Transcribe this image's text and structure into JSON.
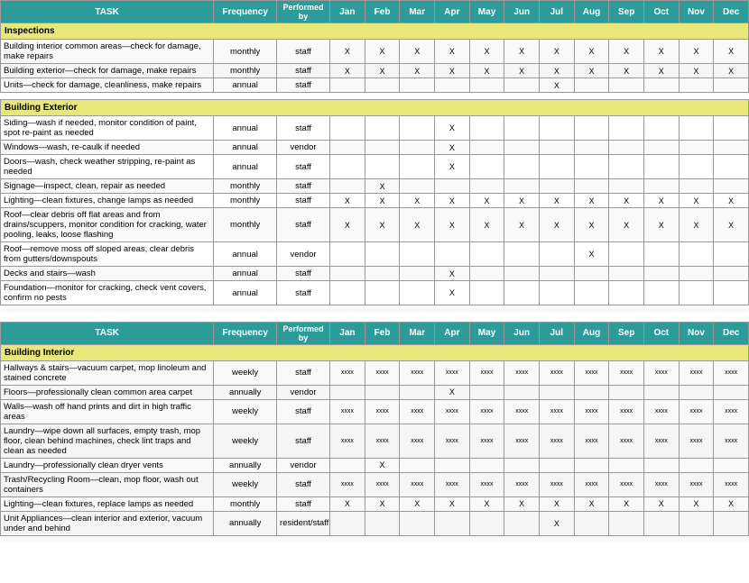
{
  "table": {
    "headers": {
      "task": "TASK",
      "frequency": "Frequency",
      "performed_by": "Performed by",
      "months": [
        "Jan",
        "Feb",
        "Mar",
        "Apr",
        "May",
        "Jun",
        "Jul",
        "Aug",
        "Sep",
        "Oct",
        "Nov",
        "Dec"
      ]
    },
    "sections": [
      {
        "name": "Inspections",
        "rows": [
          {
            "task": "Building interior common areas—check for damage, make repairs",
            "frequency": "monthly",
            "performed_by": "staff",
            "months": [
              "X",
              "X",
              "X",
              "X",
              "X",
              "X",
              "X",
              "X",
              "X",
              "X",
              "X",
              "X"
            ]
          },
          {
            "task": "Building exterior—check for damage, make repairs",
            "frequency": "monthly",
            "performed_by": "staff",
            "months": [
              "X",
              "X",
              "X",
              "X",
              "X",
              "X",
              "X",
              "X",
              "X",
              "X",
              "X",
              "X"
            ]
          },
          {
            "task": "Units—check for damage, cleanliness, make repairs",
            "frequency": "annual",
            "performed_by": "staff",
            "months": [
              "",
              "",
              "",
              "",
              "",
              "",
              "X",
              "",
              "",
              "",
              "",
              ""
            ]
          }
        ]
      },
      {
        "name": "Building Exterior",
        "rows": [
          {
            "task": "Siding—wash if needed, monitor condition of paint, spot re-paint as needed",
            "frequency": "annual",
            "performed_by": "staff",
            "months": [
              "",
              "",
              "",
              "X",
              "",
              "",
              "",
              "",
              "",
              "",
              "",
              ""
            ]
          },
          {
            "task": "Windows—wash, re-caulk if needed",
            "frequency": "annual",
            "performed_by": "vendor",
            "months": [
              "",
              "",
              "",
              "X",
              "",
              "",
              "",
              "",
              "",
              "",
              "",
              ""
            ]
          },
          {
            "task": "Doors—wash, check weather stripping, re-paint as needed",
            "frequency": "annual",
            "performed_by": "staff",
            "months": [
              "",
              "",
              "",
              "X",
              "",
              "",
              "",
              "",
              "",
              "",
              "",
              ""
            ]
          },
          {
            "task": "Signage—inspect, clean, repair as needed",
            "frequency": "monthly",
            "performed_by": "staff",
            "months": [
              "",
              "X",
              "",
              "",
              "",
              "",
              "",
              "",
              "",
              "",
              "",
              ""
            ]
          },
          {
            "task": "Lighting—clean fixtures, change lamps as needed",
            "frequency": "monthly",
            "performed_by": "staff",
            "months": [
              "X",
              "X",
              "X",
              "X",
              "X",
              "X",
              "X",
              "X",
              "X",
              "X",
              "X",
              "X"
            ]
          },
          {
            "task": "Roof—clear debris off flat areas and from drains/scuppers, monitor condition for cracking, water pooling, leaks, loose flashing",
            "frequency": "monthly",
            "performed_by": "staff",
            "months": [
              "X",
              "X",
              "X",
              "X",
              "X",
              "X",
              "X",
              "X",
              "X",
              "X",
              "X",
              "X"
            ]
          },
          {
            "task": "Roof—remove moss off sloped areas, clear debris from gutters/downspouts",
            "frequency": "annual",
            "performed_by": "vendor",
            "months": [
              "",
              "",
              "",
              "",
              "",
              "",
              "",
              "X",
              "",
              "",
              "",
              ""
            ]
          },
          {
            "task": "Decks and stairs—wash",
            "frequency": "annual",
            "performed_by": "staff",
            "months": [
              "",
              "",
              "",
              "X",
              "",
              "",
              "",
              "",
              "",
              "",
              "",
              ""
            ]
          },
          {
            "task": "Foundation—monitor for cracking, check vent covers, confirm no pests",
            "frequency": "annual",
            "performed_by": "staff",
            "months": [
              "",
              "",
              "",
              "X",
              "",
              "",
              "",
              "",
              "",
              "",
              "",
              ""
            ]
          }
        ]
      }
    ],
    "sections2": [
      {
        "name": "Building Interior",
        "rows": [
          {
            "task": "Hallways & stairs—vacuum carpet, mop linoleum and stained concrete",
            "frequency": "weekly",
            "performed_by": "staff",
            "months": [
              "xxxx",
              "xxxx",
              "xxxx",
              "xxxx",
              "xxxx",
              "xxxx",
              "xxxx",
              "xxxx",
              "xxxx",
              "xxxx",
              "xxxx",
              "xxxx"
            ]
          },
          {
            "task": "Floors—professionally clean common area carpet",
            "frequency": "annually",
            "performed_by": "vendor",
            "months": [
              "",
              "",
              "",
              "X",
              "",
              "",
              "",
              "",
              "",
              "",
              "",
              ""
            ]
          },
          {
            "task": "Walls—wash off hand prints and dirt in high traffic areas",
            "frequency": "weekly",
            "performed_by": "staff",
            "months": [
              "xxxx",
              "xxxx",
              "xxxx",
              "xxxx",
              "xxxx",
              "xxxx",
              "xxxx",
              "xxxx",
              "xxxx",
              "xxxx",
              "xxxx",
              "xxxx"
            ]
          },
          {
            "task": "Laundry—wipe down all surfaces, empty trash, mop floor, clean behind machines, check lint traps and clean as needed",
            "frequency": "weekly",
            "performed_by": "staff",
            "months": [
              "xxxx",
              "xxxx",
              "xxxx",
              "xxxx",
              "xxxx",
              "xxxx",
              "xxxx",
              "xxxx",
              "xxxx",
              "xxxx",
              "xxxx",
              "xxxx"
            ]
          },
          {
            "task": "Laundry—professionally clean dryer vents",
            "frequency": "annually",
            "performed_by": "vendor",
            "months": [
              "",
              "X",
              "",
              "",
              "",
              "",
              "",
              "",
              "",
              "",
              "",
              ""
            ]
          },
          {
            "task": "Trash/Recycling Room—clean, mop floor, wash out containers",
            "frequency": "weekly",
            "performed_by": "staff",
            "months": [
              "xxxx",
              "xxxx",
              "xxxx",
              "xxxx",
              "xxxx",
              "xxxx",
              "xxxx",
              "xxxx",
              "xxxx",
              "xxxx",
              "xxxx",
              "xxxx"
            ]
          },
          {
            "task": "Lighting—clean fixtures, replace lamps as needed",
            "frequency": "monthly",
            "performed_by": "staff",
            "months": [
              "X",
              "X",
              "X",
              "X",
              "X",
              "X",
              "X",
              "X",
              "X",
              "X",
              "X",
              "X"
            ]
          },
          {
            "task": "Unit Appliances—clean interior and exterior, vacuum under and behind",
            "frequency": "annually",
            "performed_by": "resident/staff",
            "months": [
              "",
              "",
              "",
              "",
              "",
              "",
              "X",
              "",
              "",
              "",
              "",
              ""
            ]
          }
        ]
      }
    ]
  }
}
